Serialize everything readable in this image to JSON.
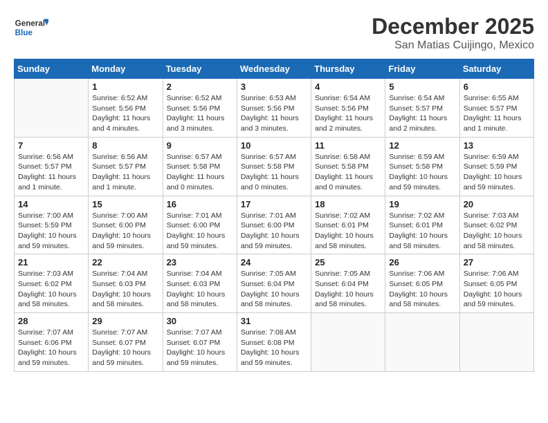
{
  "logo": {
    "text_general": "General",
    "text_blue": "Blue"
  },
  "title": "December 2025",
  "subtitle": "San Matias Cuijingo, Mexico",
  "days_header": [
    "Sunday",
    "Monday",
    "Tuesday",
    "Wednesday",
    "Thursday",
    "Friday",
    "Saturday"
  ],
  "weeks": [
    [
      {
        "day": "",
        "info": ""
      },
      {
        "day": "1",
        "info": "Sunrise: 6:52 AM\nSunset: 5:56 PM\nDaylight: 11 hours\nand 4 minutes."
      },
      {
        "day": "2",
        "info": "Sunrise: 6:52 AM\nSunset: 5:56 PM\nDaylight: 11 hours\nand 3 minutes."
      },
      {
        "day": "3",
        "info": "Sunrise: 6:53 AM\nSunset: 5:56 PM\nDaylight: 11 hours\nand 3 minutes."
      },
      {
        "day": "4",
        "info": "Sunrise: 6:54 AM\nSunset: 5:56 PM\nDaylight: 11 hours\nand 2 minutes."
      },
      {
        "day": "5",
        "info": "Sunrise: 6:54 AM\nSunset: 5:57 PM\nDaylight: 11 hours\nand 2 minutes."
      },
      {
        "day": "6",
        "info": "Sunrise: 6:55 AM\nSunset: 5:57 PM\nDaylight: 11 hours\nand 1 minute."
      }
    ],
    [
      {
        "day": "7",
        "info": "Sunrise: 6:56 AM\nSunset: 5:57 PM\nDaylight: 11 hours\nand 1 minute."
      },
      {
        "day": "8",
        "info": "Sunrise: 6:56 AM\nSunset: 5:57 PM\nDaylight: 11 hours\nand 1 minute."
      },
      {
        "day": "9",
        "info": "Sunrise: 6:57 AM\nSunset: 5:58 PM\nDaylight: 11 hours\nand 0 minutes."
      },
      {
        "day": "10",
        "info": "Sunrise: 6:57 AM\nSunset: 5:58 PM\nDaylight: 11 hours\nand 0 minutes."
      },
      {
        "day": "11",
        "info": "Sunrise: 6:58 AM\nSunset: 5:58 PM\nDaylight: 11 hours\nand 0 minutes."
      },
      {
        "day": "12",
        "info": "Sunrise: 6:59 AM\nSunset: 5:58 PM\nDaylight: 10 hours\nand 59 minutes."
      },
      {
        "day": "13",
        "info": "Sunrise: 6:59 AM\nSunset: 5:59 PM\nDaylight: 10 hours\nand 59 minutes."
      }
    ],
    [
      {
        "day": "14",
        "info": "Sunrise: 7:00 AM\nSunset: 5:59 PM\nDaylight: 10 hours\nand 59 minutes."
      },
      {
        "day": "15",
        "info": "Sunrise: 7:00 AM\nSunset: 6:00 PM\nDaylight: 10 hours\nand 59 minutes."
      },
      {
        "day": "16",
        "info": "Sunrise: 7:01 AM\nSunset: 6:00 PM\nDaylight: 10 hours\nand 59 minutes."
      },
      {
        "day": "17",
        "info": "Sunrise: 7:01 AM\nSunset: 6:00 PM\nDaylight: 10 hours\nand 59 minutes."
      },
      {
        "day": "18",
        "info": "Sunrise: 7:02 AM\nSunset: 6:01 PM\nDaylight: 10 hours\nand 58 minutes."
      },
      {
        "day": "19",
        "info": "Sunrise: 7:02 AM\nSunset: 6:01 PM\nDaylight: 10 hours\nand 58 minutes."
      },
      {
        "day": "20",
        "info": "Sunrise: 7:03 AM\nSunset: 6:02 PM\nDaylight: 10 hours\nand 58 minutes."
      }
    ],
    [
      {
        "day": "21",
        "info": "Sunrise: 7:03 AM\nSunset: 6:02 PM\nDaylight: 10 hours\nand 58 minutes."
      },
      {
        "day": "22",
        "info": "Sunrise: 7:04 AM\nSunset: 6:03 PM\nDaylight: 10 hours\nand 58 minutes."
      },
      {
        "day": "23",
        "info": "Sunrise: 7:04 AM\nSunset: 6:03 PM\nDaylight: 10 hours\nand 58 minutes."
      },
      {
        "day": "24",
        "info": "Sunrise: 7:05 AM\nSunset: 6:04 PM\nDaylight: 10 hours\nand 58 minutes."
      },
      {
        "day": "25",
        "info": "Sunrise: 7:05 AM\nSunset: 6:04 PM\nDaylight: 10 hours\nand 58 minutes."
      },
      {
        "day": "26",
        "info": "Sunrise: 7:06 AM\nSunset: 6:05 PM\nDaylight: 10 hours\nand 58 minutes."
      },
      {
        "day": "27",
        "info": "Sunrise: 7:06 AM\nSunset: 6:05 PM\nDaylight: 10 hours\nand 59 minutes."
      }
    ],
    [
      {
        "day": "28",
        "info": "Sunrise: 7:07 AM\nSunset: 6:06 PM\nDaylight: 10 hours\nand 59 minutes."
      },
      {
        "day": "29",
        "info": "Sunrise: 7:07 AM\nSunset: 6:07 PM\nDaylight: 10 hours\nand 59 minutes."
      },
      {
        "day": "30",
        "info": "Sunrise: 7:07 AM\nSunset: 6:07 PM\nDaylight: 10 hours\nand 59 minutes."
      },
      {
        "day": "31",
        "info": "Sunrise: 7:08 AM\nSunset: 6:08 PM\nDaylight: 10 hours\nand 59 minutes."
      },
      {
        "day": "",
        "info": ""
      },
      {
        "day": "",
        "info": ""
      },
      {
        "day": "",
        "info": ""
      }
    ]
  ]
}
